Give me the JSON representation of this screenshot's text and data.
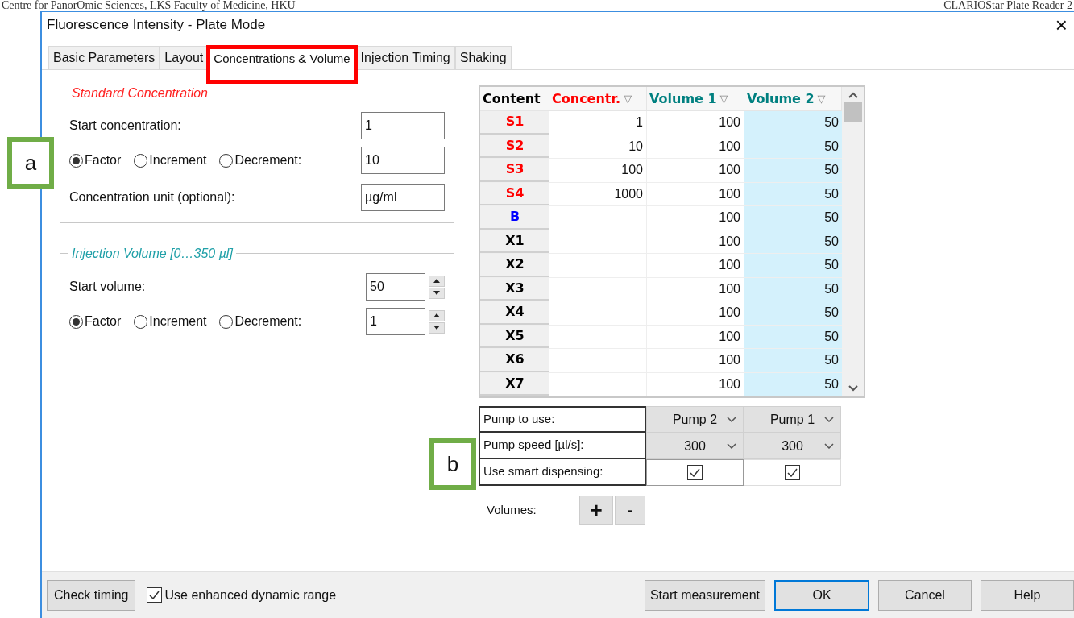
{
  "page_header": {
    "left": "Centre for PanorOmic Sciences, LKS Faculty of Medicine, HKU",
    "right": "CLARIOStar Plate Reader 2"
  },
  "window": {
    "title": "Fluorescence Intensity  -  Plate Mode",
    "close": "×"
  },
  "tabs": [
    {
      "label": "Basic Parameters",
      "selected": false,
      "highlighted": false
    },
    {
      "label": "Layout",
      "selected": false,
      "highlighted": false
    },
    {
      "label": "Concentrations & Volume",
      "selected": true,
      "highlighted": true
    },
    {
      "label": "Injection Timing",
      "selected": false,
      "highlighted": false
    },
    {
      "label": "Shaking",
      "selected": false,
      "highlighted": false
    }
  ],
  "standard_concentration": {
    "title": "Standard Concentration",
    "start_label": "Start concentration:",
    "start_value": "1",
    "mode_options": [
      {
        "label": "Factor",
        "selected": true
      },
      {
        "label": "Increment",
        "selected": false
      },
      {
        "label": "Decrement:",
        "selected": false
      }
    ],
    "mode_value": "10",
    "unit_label": "Concentration unit (optional):",
    "unit_value": "µg/ml"
  },
  "injection_volume": {
    "title": "Injection Volume [0…350 µl]",
    "start_label": "Start volume:",
    "start_value": "50",
    "mode_options": [
      {
        "label": "Factor",
        "selected": true
      },
      {
        "label": "Increment",
        "selected": false
      },
      {
        "label": "Decrement:",
        "selected": false
      }
    ],
    "mode_value": "1"
  },
  "table": {
    "columns": [
      {
        "label": "Content",
        "color": "#000000"
      },
      {
        "label": "Concentr.",
        "color": "#ff0000",
        "filter": "▽"
      },
      {
        "label": "Volume 1",
        "color": "#008080",
        "filter": "▽"
      },
      {
        "label": "Volume 2",
        "color": "#008080",
        "filter": "▽"
      }
    ],
    "rows": [
      {
        "content": "S1",
        "color": "#ff0000",
        "concentration": "1",
        "volume_1": "100",
        "volume_2": "50"
      },
      {
        "content": "S2",
        "color": "#ff0000",
        "concentration": "10",
        "volume_1": "100",
        "volume_2": "50"
      },
      {
        "content": "S3",
        "color": "#ff0000",
        "concentration": "100",
        "volume_1": "100",
        "volume_2": "50"
      },
      {
        "content": "S4",
        "color": "#ff0000",
        "concentration": "1000",
        "volume_1": "100",
        "volume_2": "50"
      },
      {
        "content": "B",
        "color": "#0000ff",
        "volume_1": "100",
        "volume_2": "50"
      },
      {
        "content": "X1",
        "color": "#000000",
        "volume_1": "100",
        "volume_2": "50"
      },
      {
        "content": "X2",
        "color": "#000000",
        "volume_1": "100",
        "volume_2": "50"
      },
      {
        "content": "X3",
        "color": "#000000",
        "volume_1": "100",
        "volume_2": "50"
      },
      {
        "content": "X4",
        "color": "#000000",
        "volume_1": "100",
        "volume_2": "50"
      },
      {
        "content": "X5",
        "color": "#000000",
        "volume_1": "100",
        "volume_2": "50"
      },
      {
        "content": "X6",
        "color": "#000000",
        "volume_1": "100",
        "volume_2": "50"
      },
      {
        "content": "X7",
        "color": "#000000",
        "volume_1": "100",
        "volume_2": "50"
      }
    ]
  },
  "pump_settings": {
    "rows": [
      {
        "label": "Pump to use:",
        "kind": "dropdown",
        "values": [
          "Pump 2",
          "Pump 1"
        ]
      },
      {
        "label": "Pump speed [µl/s]:",
        "kind": "dropdown",
        "values": [
          "300",
          "300"
        ]
      },
      {
        "label": "Use smart dispensing:",
        "kind": "checkbox",
        "checked": [
          true,
          true
        ]
      }
    ]
  },
  "volumes": {
    "label": "Volumes:",
    "add": "+",
    "remove": "-"
  },
  "annotations": [
    {
      "label": "a"
    },
    {
      "label": "b"
    }
  ],
  "footer": {
    "check_timing": "Check timing",
    "enhanced_range": {
      "label": "Use enhanced dynamic range",
      "checked": true
    },
    "buttons": [
      {
        "label": "Start measurement",
        "default": false
      },
      {
        "label": "OK",
        "default": true
      },
      {
        "label": "Cancel",
        "default": false
      },
      {
        "label": "Help",
        "default": false
      }
    ]
  }
}
